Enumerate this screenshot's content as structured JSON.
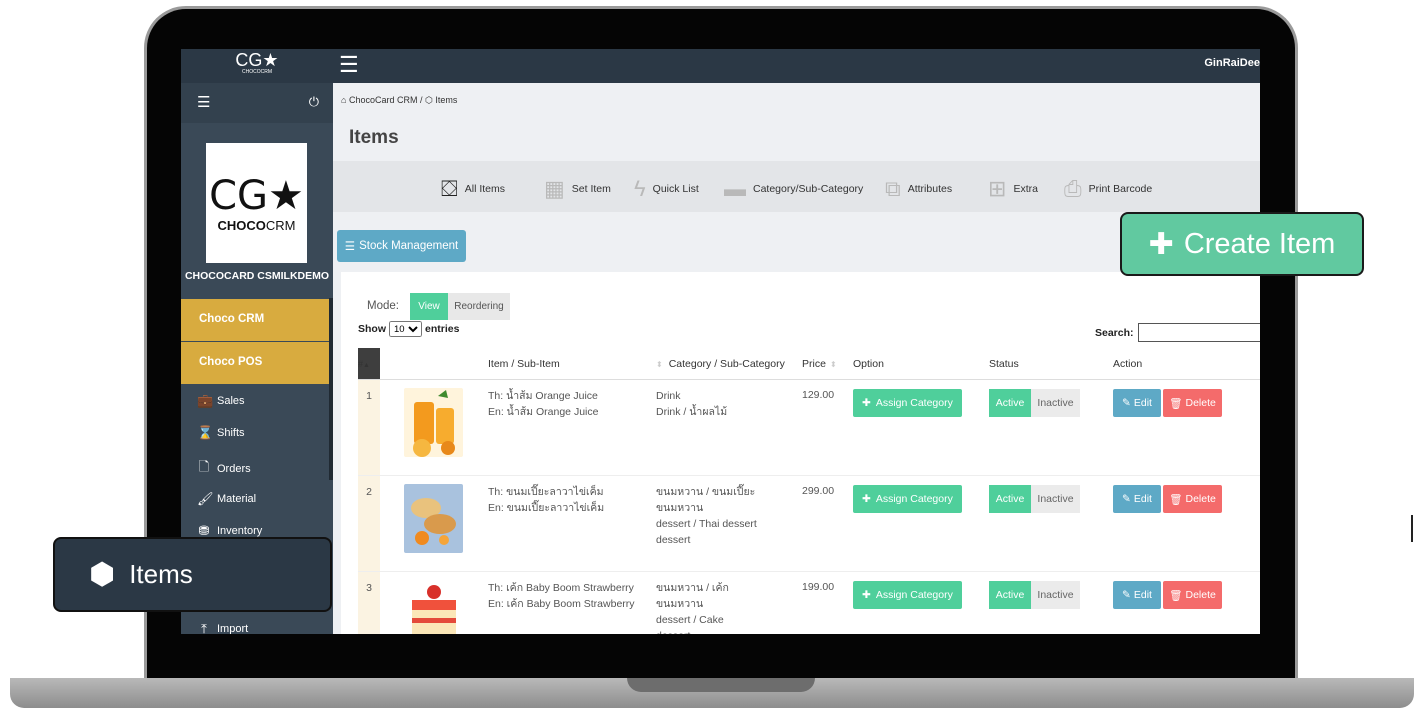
{
  "app": {
    "logo_text": "CG★",
    "logo_sub": "CHOCOCRM",
    "user_name": "GinRaiDee"
  },
  "sidebar": {
    "logo_mark": "CG★",
    "logo_brand_bold": "CHOCO",
    "logo_brand_rest": "CRM",
    "company": "CHOCOCARD CSMILKDEMO",
    "gold_items": [
      {
        "label": "Choco CRM"
      },
      {
        "label": "Choco POS"
      }
    ],
    "items": [
      {
        "label": "Sales",
        "icon": "briefcase-icon",
        "glyph": "💼"
      },
      {
        "label": "Shifts",
        "icon": "hourglass-icon",
        "glyph": "⌛"
      },
      {
        "label": "Orders",
        "icon": "file-icon",
        "glyph": "🗋"
      },
      {
        "label": "Material",
        "icon": "brush-icon",
        "glyph": "🖌"
      },
      {
        "label": "Inventory",
        "icon": "boxes-icon",
        "glyph": "⛃"
      },
      {
        "label": "Import",
        "icon": "upload-icon",
        "glyph": "⤒"
      }
    ]
  },
  "breadcrumb": {
    "home": "ChocoCard CRM",
    "separator": "/",
    "current": "Items"
  },
  "page_title": "Items",
  "toolbar": {
    "items": [
      {
        "label": "All Items",
        "icon": "cubes-icon"
      },
      {
        "label": "Set Item",
        "icon": "grid-icon"
      },
      {
        "label": "Quick List",
        "icon": "bolt-icon"
      },
      {
        "label": "Category/Sub-Category",
        "icon": "folder-icon"
      },
      {
        "label": "Attributes",
        "icon": "crop-icon"
      },
      {
        "label": "Extra",
        "icon": "plus-square-icon"
      },
      {
        "label": "Print Barcode",
        "icon": "print-icon"
      }
    ]
  },
  "stock_button": "Stock Management",
  "mode": {
    "label": "Mode:",
    "view": "View",
    "reorder": "Reordering"
  },
  "show": {
    "prefix": "Show",
    "value": "10",
    "suffix": "entries"
  },
  "search": {
    "label": "Search:",
    "value": ""
  },
  "table": {
    "headers": {
      "idx": "#",
      "item": "Item / Sub-Item",
      "category": "Category / Sub-Category",
      "price": "Price",
      "option": "Option",
      "status": "Status",
      "action": "Action"
    },
    "assign_label": "Assign Category",
    "active_label": "Active",
    "inactive_label": "Inactive",
    "edit_label": "Edit",
    "delete_label": "Delete",
    "rows": [
      {
        "idx": "1",
        "th": "Th: น้ำส้ม Orange Juice",
        "en": "En: น้ำส้ม Orange Juice",
        "cat1": "Drink",
        "cat2": "Drink / น้ำผลไม้",
        "cat3": "",
        "cat4": "",
        "price": "129.00"
      },
      {
        "idx": "2",
        "th": "Th: ขนมเปี๊ยะลาวาไข่เค็ม",
        "en": "En: ขนมเปี๊ยะลาวาไข่เค็ม",
        "cat1": "ขนมหวาน / ขนมเปี๊ยะ",
        "cat2": "ขนมหวาน",
        "cat3": "dessert / Thai dessert",
        "cat4": "dessert",
        "price": "299.00"
      },
      {
        "idx": "3",
        "th": "Th: เค้ก Baby Boom Strawberry",
        "en": "En: เค้ก Baby Boom Strawberry",
        "cat1": "ขนมหวาน / เค้ก",
        "cat2": "ขนมหวาน",
        "cat3": "dessert / Cake",
        "cat4": "dessert",
        "price": "199.00"
      }
    ]
  },
  "callouts": {
    "create_item": "Create Item",
    "items": "Items"
  },
  "colors": {
    "topbar": "#2b3845",
    "sidebar": "#3a4957",
    "gold": "#d8ab3f",
    "green": "#4fcf9b",
    "blue": "#5ea9c6",
    "red": "#f46b6b",
    "callout_green": "#61c9a0"
  }
}
